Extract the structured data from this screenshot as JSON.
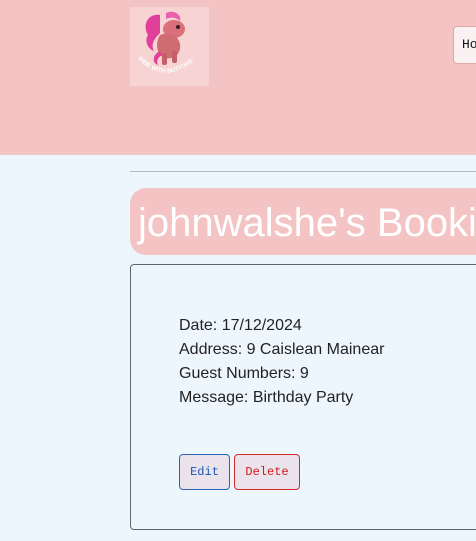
{
  "header": {
    "logo_text": "RIDE WITH BUTTONS",
    "nav": [
      {
        "label": "Home"
      }
    ]
  },
  "booking": {
    "title": "johnwalshe's Booking",
    "details": [
      {
        "text": "Date: 17/12/2024"
      },
      {
        "text": "Address: 9 Caislean Mainear"
      },
      {
        "text": "Guest Numbers: 9"
      },
      {
        "text": "Message: Birthday Party"
      }
    ],
    "edit_label": "Edit",
    "delete_label": "Delete"
  },
  "colors": {
    "header_bg": "#f4c3c3",
    "page_bg": "#eef6fd",
    "edit_accent": "#1e56b3",
    "delete_accent": "#d11a1a"
  }
}
